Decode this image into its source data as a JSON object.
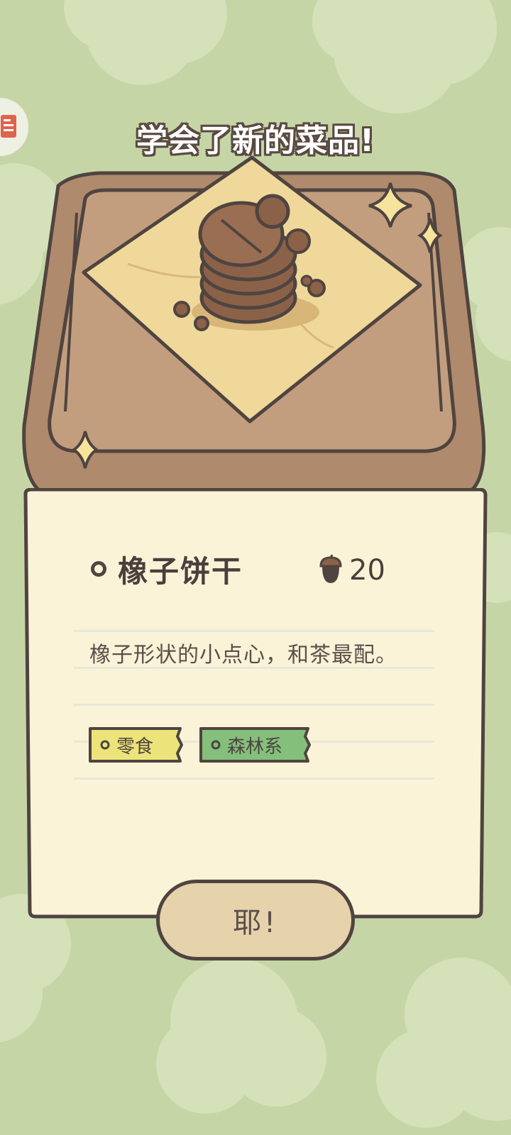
{
  "popup": {
    "title": "学会了新的菜品!",
    "dish_name": "橡子饼干",
    "price": "20",
    "description": "橡子形状的小点心，和茶最配。",
    "tags": [
      "零食",
      "森林系"
    ],
    "confirm_label": "耶!"
  },
  "icons": {
    "side_button": "menu-book-icon",
    "price": "acorn-icon",
    "dish_image": "acorn-cookie-stack-icon",
    "sparkle": "sparkle-icon"
  },
  "colors": {
    "background": "#c6d5a5",
    "card": "#fbf3d8",
    "tray": "#b08a6c",
    "tag_snack": "#ece47a",
    "tag_forest": "#84c07c",
    "button": "#e6d2ab",
    "outline": "#4f4440"
  }
}
